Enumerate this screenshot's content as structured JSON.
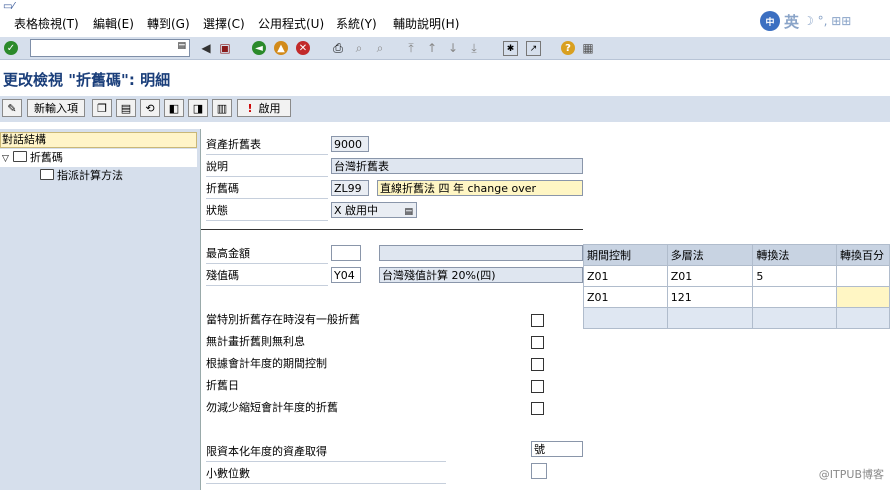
{
  "menu": {
    "items": [
      "表格檢視(T)",
      "編輯(E)",
      "轉到(G)",
      "選擇(C)",
      "公用程式(U)",
      "系統(Y)",
      "輔助說明(H)"
    ],
    "ime_logo": "中",
    "ime_label": "英",
    "ime_symbols": "☽ °, ⊞⊞"
  },
  "toolbar": {
    "command_value": ""
  },
  "page": {
    "title": "更改檢視 \"折舊碼\": 明細"
  },
  "app_toolbar": {
    "new_entries_label": "新輸入項",
    "activate_label": "啟用"
  },
  "tree": {
    "header": "對話結構",
    "items": [
      {
        "label": "折舊碼",
        "expanded_marker": "▽"
      },
      {
        "label": "指派計算方法"
      }
    ]
  },
  "form": {
    "asset_table": {
      "label": "資產折舊表",
      "value": "9000"
    },
    "description": {
      "label": "說明",
      "value": "台灣折舊表"
    },
    "dep_key": {
      "label": "折舊碼",
      "value": "ZL99",
      "text": "直線折舊法 四 年 change over"
    },
    "status": {
      "label": "狀態",
      "value": "X 啟用中"
    },
    "max_amount": {
      "label": "最高金額",
      "value": ""
    },
    "residual_key": {
      "label": "殘值碼",
      "value": "Y04",
      "text": "台灣殘值計算 20%(四)"
    },
    "checkboxes": [
      {
        "label": "當特別折舊存在時沒有一般折舊",
        "checked": false
      },
      {
        "label": "無計畫折舊則無利息",
        "checked": false
      },
      {
        "label": "根據會計年度的期間控制",
        "checked": false
      },
      {
        "label": "折舊日",
        "checked": false
      },
      {
        "label": "勿減少縮短會計年度的折舊",
        "checked": false
      }
    ],
    "capitalization": {
      "label": "限資本化年度的資產取得",
      "value": "號"
    },
    "decimal_places": {
      "label": "小數位數",
      "value": ""
    }
  },
  "method_table": {
    "columns": [
      "期間控制",
      "多層法",
      "轉換法",
      "轉換百分"
    ],
    "rows": [
      [
        "Z01",
        "Z01",
        "5",
        ""
      ],
      [
        "Z01",
        "121",
        "",
        ""
      ],
      [
        "",
        "",
        "",
        ""
      ]
    ]
  },
  "watermark": "@ITPUB博客",
  "colors": {
    "sap_blue": "#d6dfec",
    "title_blue": "#1a3e7a",
    "highlight_yellow": "#fff6c4"
  }
}
